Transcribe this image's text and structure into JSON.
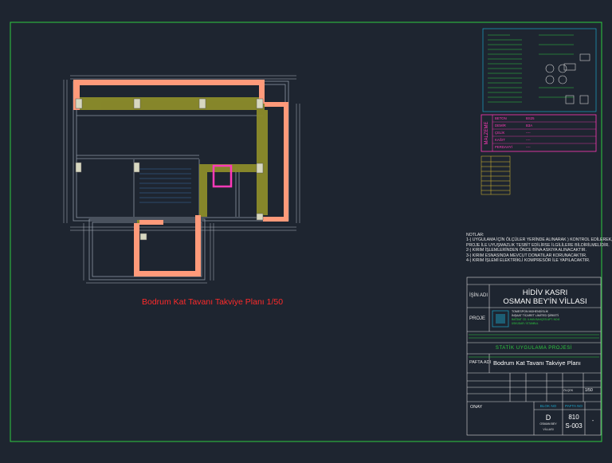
{
  "plan": {
    "title": "Bodrum Kat Tavanı Takviye Planı  1/50"
  },
  "notes": {
    "heading": "NOTLAR:",
    "lines": [
      "1-) UYGULAMA İÇİN ÖLÇÜLER YERİNDE ALINARAK ) KONTROL EDİLEREK,",
      "PROJE İLE UYUŞMAZLIK TESBİT EDİLİRSE İLGİLİLERE BİLDİRİLMELİDİR.",
      "2-) KIRIM İŞLEMLERİNDEN ÖNCE BİNA ASKIYA ALINACAKTIR.",
      "3-) KIRIM ESNASINDA MEVCUT DONATILAR KORUNACAKTIR.",
      "4-) KIRIM İŞLEMİ ELEKTRİKLİ KOMPRESÖR İLE YAPILACAKTIR."
    ]
  },
  "material": {
    "side_label": "MALZEME",
    "rows": [
      {
        "label": "BETON",
        "value": "BS25"
      },
      {
        "label": "DEMİR",
        "value": "B3A"
      },
      {
        "label": "ÇELİK",
        "value": "----"
      },
      {
        "label": "KAĞIT",
        "value": "----"
      },
      {
        "label": "PERDAHYİ",
        "value": "----"
      }
    ]
  },
  "title_block": {
    "job_label": "İŞİN ADI",
    "job_line1": "HİDİV KASRI",
    "job_line2": "OSMAN BEY'İN VİLLASI",
    "project_label": "PROJE",
    "firm_line1": "TOMESPON MÜHENDİSLİK",
    "firm_line2": "İNŞAAT TİCARET LİMİTED ŞİRKETİ",
    "firm_line3": "BAĞDAT CD. ILHAN BAHÇESİ APT. NO:8",
    "firm_line4": "ÜSKÜDAR / İSTANBUL",
    "section_title": "STATİK UYGULAMA PROJESİ",
    "sheet_label": "PAFTA ADI",
    "sheet_name": "Bodrum Kat Tavanı Takviye Planı",
    "scale_label": "ÖLÇEK",
    "scale_value": "1/50",
    "approval_label": "ONAY",
    "block_label": "BLOK NO",
    "block_value": "D",
    "block_sub1": "OSMAN BEY",
    "block_sub2": "VİLLASI",
    "sheet_no_label": "PAFTA NO",
    "sheet_no_value": "810",
    "sheet_no_sub": "S-003",
    "rev_value": "-"
  }
}
